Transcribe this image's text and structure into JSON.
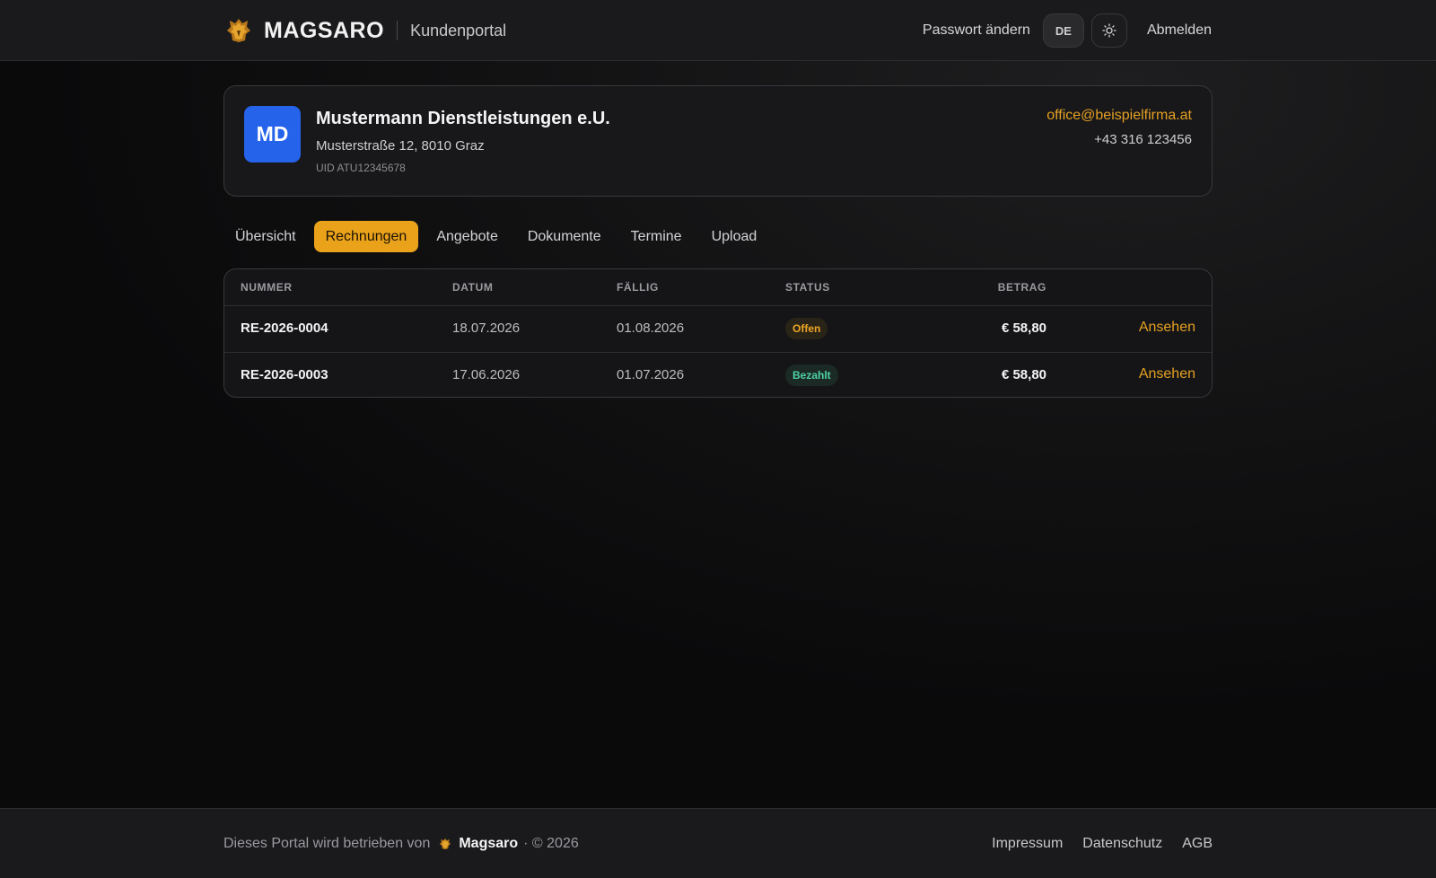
{
  "header": {
    "brand_name": "MAGSARO",
    "brand_sub": "Kundenportal",
    "change_password": "Passwort ändern",
    "language": "DE",
    "theme_icon": "sun-icon",
    "logout": "Abmelden"
  },
  "company": {
    "initials": "MD",
    "name": "Mustermann Dienstleistungen e.U.",
    "address": "Musterstraße 12, 8010 Graz",
    "uid": "UID ATU12345678",
    "email": "office@beispielfirma.at",
    "phone": "+43 316 123456"
  },
  "tabs": [
    {
      "label": "Übersicht",
      "active": false
    },
    {
      "label": "Rechnungen",
      "active": true
    },
    {
      "label": "Angebote",
      "active": false
    },
    {
      "label": "Dokumente",
      "active": false
    },
    {
      "label": "Termine",
      "active": false
    },
    {
      "label": "Upload",
      "active": false
    }
  ],
  "invoices": {
    "columns": [
      "NUMMER",
      "DATUM",
      "FÄLLIG",
      "STATUS",
      "BETRAG"
    ],
    "rows": [
      {
        "number": "RE-2026-0004",
        "date": "18.07.2026",
        "due": "01.08.2026",
        "status": "Offen",
        "amount": "€ 58,80",
        "action": "Ansehen"
      },
      {
        "number": "RE-2026-0003",
        "date": "17.06.2026",
        "due": "01.07.2026",
        "status": "Bezahlt",
        "amount": "€ 58,80",
        "action": "Ansehen"
      }
    ]
  },
  "footer": {
    "text": "Dieses Portal wird betrieben von",
    "brand": "Magsaro",
    "copyright": "· © 2026",
    "links": [
      "Impressum",
      "Datenschutz",
      "AGB"
    ]
  },
  "colors": {
    "accent": "#eaa21a",
    "avatar": "#2563eb",
    "status_open": "#f0a623",
    "status_paid": "#4fd1a5"
  }
}
